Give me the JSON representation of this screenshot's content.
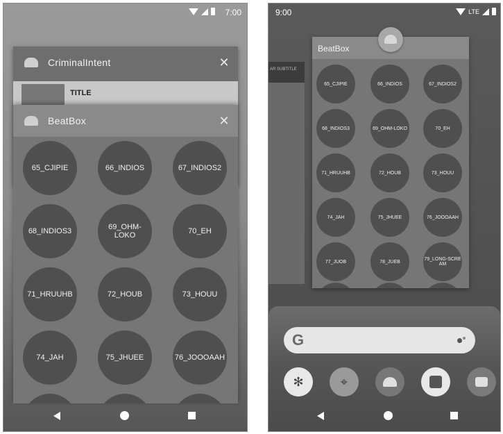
{
  "left": {
    "status": {
      "time": "7:00"
    },
    "criminal_card": {
      "title": "CriminalIntent",
      "close": "✕",
      "row_title": "TITLE"
    },
    "beatbox_card": {
      "title": "BeatBox",
      "close": "✕",
      "sounds": [
        "65_CJIPIE",
        "66_INDIOS",
        "67_INDIOS2",
        "68_INDIOS3",
        "69_OHM-LOKO",
        "70_EH",
        "71_HRUUHB",
        "72_HOUB",
        "73_HOUU",
        "74_JAH",
        "75_JHUEE",
        "76_JOOOAAH"
      ]
    }
  },
  "right": {
    "status": {
      "time": "9:00",
      "network": "LTE"
    },
    "prev_card_text": "AR SUBTITLE",
    "beatbox_card": {
      "title": "BeatBox",
      "sounds": [
        "65_CJIPIE",
        "66_INDIOS",
        "67_INDIOS2",
        "68_INDIOS3",
        "69_OHM-LOKO",
        "70_EH",
        "71_HRUUHB",
        "72_HOUB",
        "73_HOUU",
        "74_JAH",
        "75_JHUEE",
        "76_JOOOAAH",
        "77_JUOB",
        "78_JUEB",
        "79_LONG-SCRE AM"
      ]
    },
    "search_logo": "G",
    "dock_apps": [
      "pinwheel-icon",
      "maps-icon",
      "android-icon",
      "contacts-icon",
      "messages-icon"
    ]
  }
}
